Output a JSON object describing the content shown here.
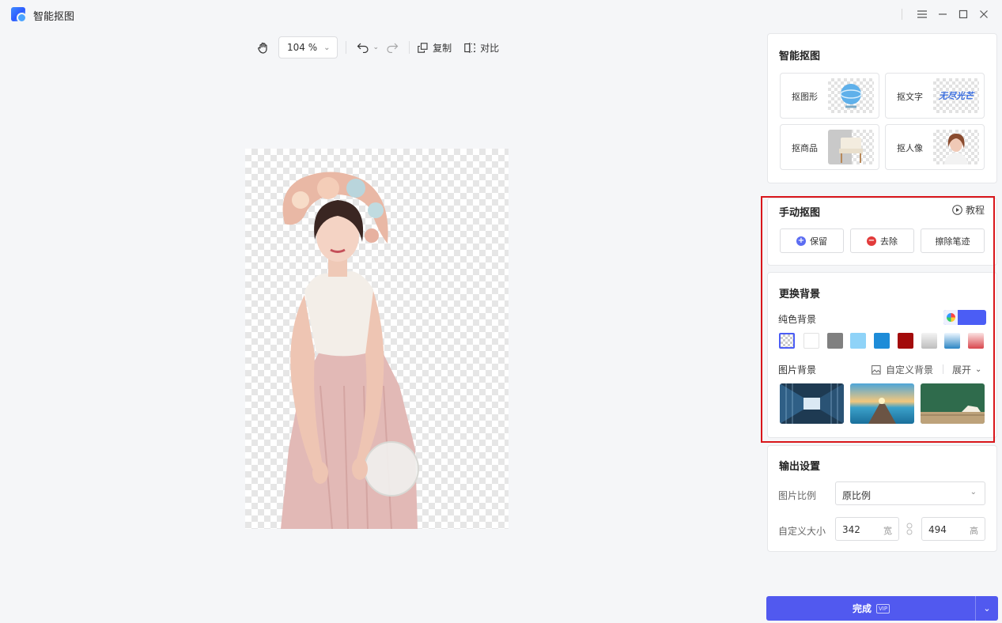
{
  "app": {
    "title": "智能抠图"
  },
  "toolbar": {
    "zoom": "104 %",
    "copy_label": "复制",
    "compare_label": "对比"
  },
  "smart_cutout": {
    "title": "智能抠图",
    "tools": [
      {
        "label": "抠图形",
        "icon": "globe-image"
      },
      {
        "label": "抠文字",
        "icon": "text-image",
        "preview_text": "无尽光芒"
      },
      {
        "label": "抠商品",
        "icon": "chair-image"
      },
      {
        "label": "抠人像",
        "icon": "portrait-image"
      }
    ]
  },
  "manual_cutout": {
    "title": "手动抠图",
    "tutorial_label": "教程",
    "keep_label": "保留",
    "remove_label": "去除",
    "erase_label": "擦除笔迹"
  },
  "background": {
    "title": "更换背景",
    "solid_label": "纯色背景",
    "solid_swatches": [
      "transparent",
      "#ffffff",
      "#808080",
      "#8fd3f8",
      "#1e8cd8",
      "#a30b0b",
      "gradient-gray",
      "gradient-blue",
      "gradient-red"
    ],
    "current_color": "#4b5df5",
    "image_label": "图片背景",
    "custom_bg_label": "自定义背景",
    "expand_label": "展开",
    "image_options": [
      "glass-corridor",
      "pier-sunset",
      "chalkboard-books"
    ]
  },
  "output": {
    "title": "输出设置",
    "ratio_label": "图片比例",
    "ratio_value": "原比例",
    "size_label": "自定义大小",
    "width_value": "342",
    "width_unit": "宽",
    "height_value": "494",
    "height_unit": "高"
  },
  "done": {
    "label": "完成",
    "badge": "VIP"
  },
  "colors": {
    "accent": "#5159ef",
    "highlight_frame": "#d9161b"
  }
}
